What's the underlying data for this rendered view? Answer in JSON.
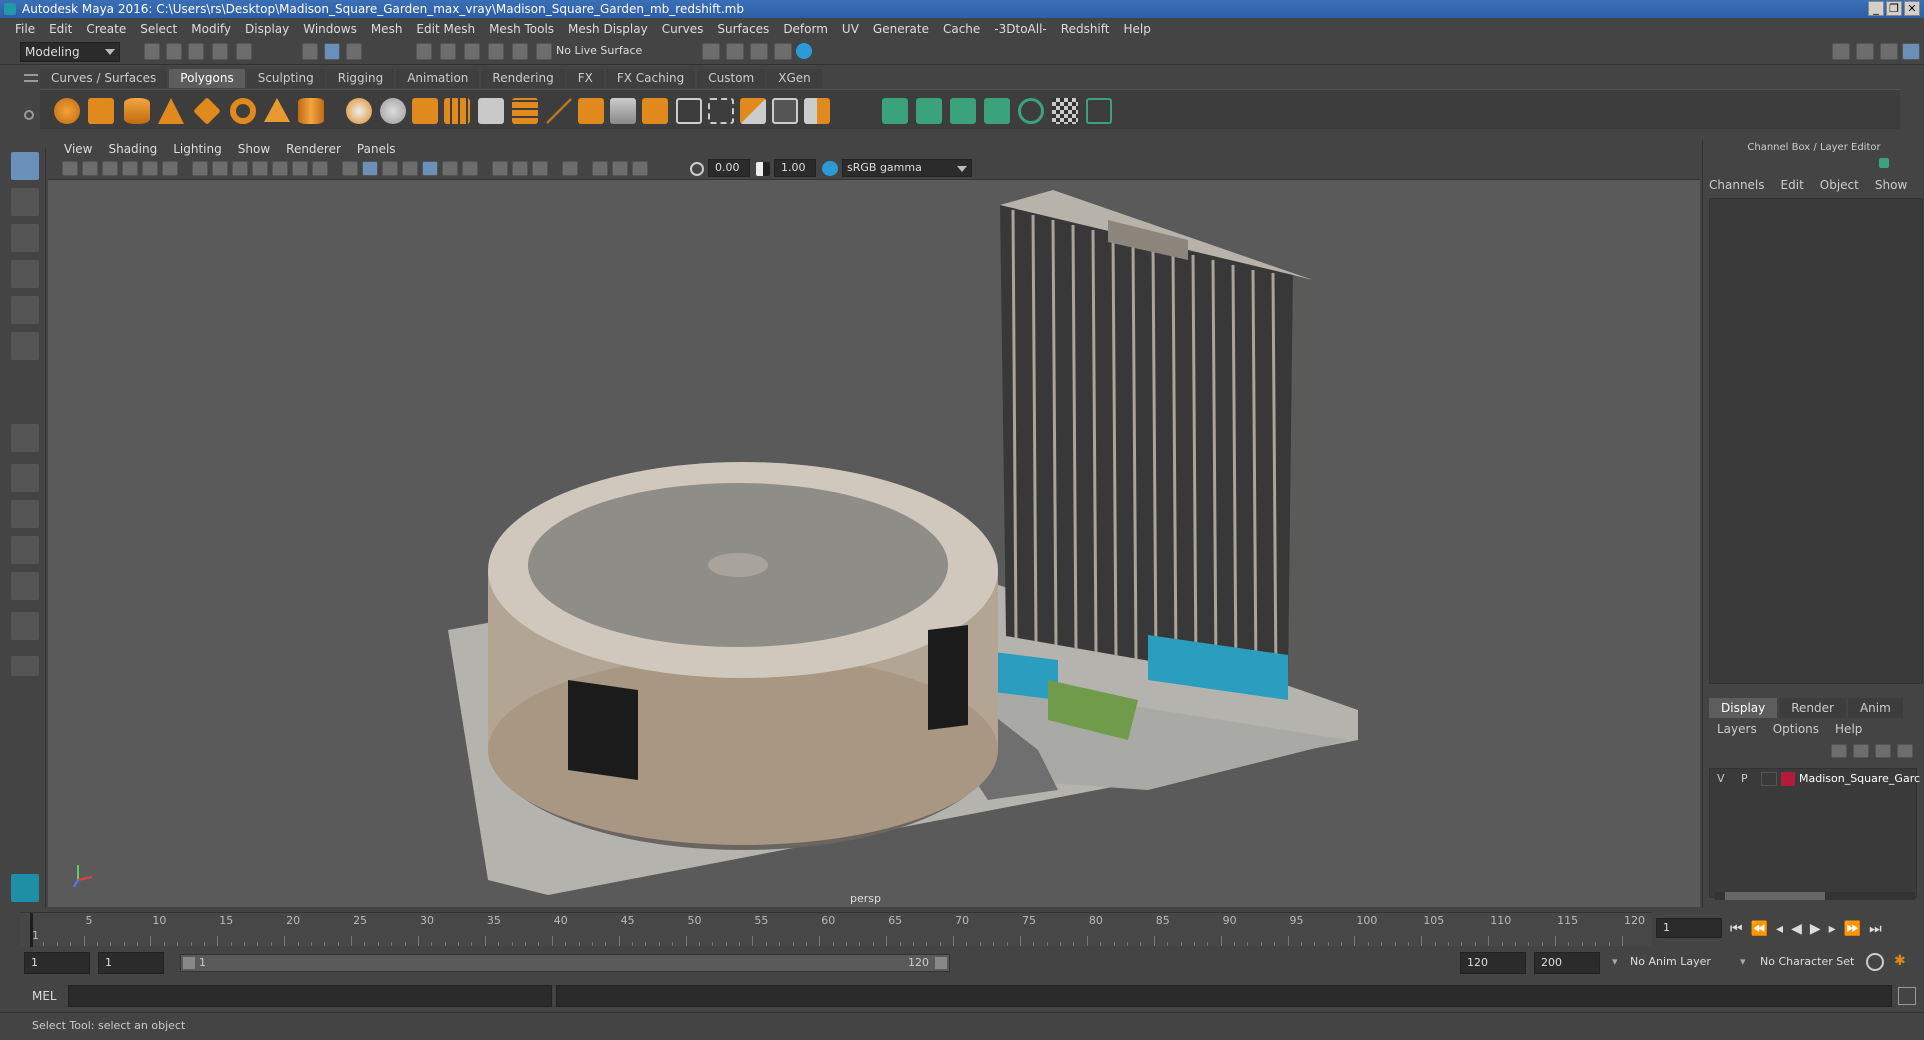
{
  "window": {
    "title": "Autodesk Maya 2016: C:\\Users\\rs\\Desktop\\Madison_Square_Garden_max_vray\\Madison_Square_Garden_mb_redshift.mb",
    "controls": [
      "_",
      "❐",
      "✕"
    ]
  },
  "menubar": [
    "File",
    "Edit",
    "Create",
    "Select",
    "Modify",
    "Display",
    "Windows",
    "Mesh",
    "Edit Mesh",
    "Mesh Tools",
    "Mesh Display",
    "Curves",
    "Surfaces",
    "Deform",
    "UV",
    "Generate",
    "Cache",
    "-3DtoAll-",
    "Redshift",
    "Help"
  ],
  "statusline": {
    "mode": "Modeling",
    "live_surface": "No Live Surface"
  },
  "shelf": {
    "tabs": [
      "Curves / Surfaces",
      "Polygons",
      "Sculpting",
      "Rigging",
      "Animation",
      "Rendering",
      "FX",
      "FX Caching",
      "Custom",
      "XGen"
    ],
    "active_tab": "Polygons"
  },
  "viewport": {
    "menu": [
      "View",
      "Shading",
      "Lighting",
      "Show",
      "Renderer",
      "Panels"
    ],
    "exposure": "0.00",
    "gamma": "1.00",
    "color_space": "sRGB gamma",
    "camera_label": "persp"
  },
  "channel_box": {
    "title": "Channel Box / Layer Editor",
    "menu": [
      "Channels",
      "Edit",
      "Object",
      "Show"
    ]
  },
  "layer_editor": {
    "tabs": [
      "Display",
      "Render",
      "Anim"
    ],
    "active_tab": "Display",
    "menu": [
      "Layers",
      "Options",
      "Help"
    ],
    "layer": {
      "v": "V",
      "p": "P",
      "name": "Madison_Square_Garc",
      "color": "#b01c3a"
    }
  },
  "timeline": {
    "ticks": [
      "1",
      "5",
      "10",
      "15",
      "20",
      "25",
      "30",
      "35",
      "40",
      "45",
      "50",
      "55",
      "60",
      "65",
      "70",
      "75",
      "80",
      "85",
      "90",
      "95",
      "100",
      "105",
      "110",
      "115",
      "120"
    ],
    "current_frame": "1"
  },
  "range": {
    "start": "1",
    "playback_start": "1",
    "slider_start": "1",
    "slider_end": "120",
    "playback_end": "120",
    "end": "200",
    "anim_layer": "No Anim Layer",
    "character_set": "No Character Set"
  },
  "command_line": {
    "label": "MEL"
  },
  "help_line": "Select Tool: select an object",
  "colors": {
    "accent": "#5b9bd5",
    "shelf_icon": "#e08a1e",
    "shelf_icon_green": "#3aa37c"
  }
}
